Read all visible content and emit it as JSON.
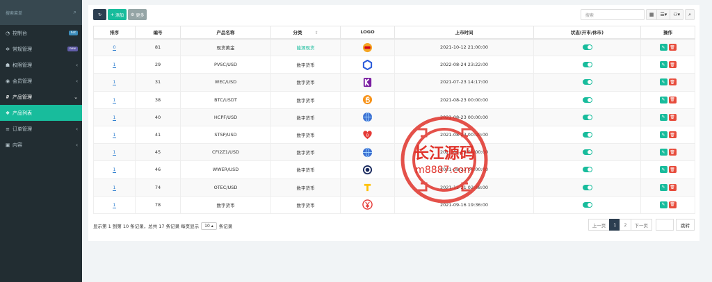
{
  "sidebar": {
    "search_placeholder": "搜索菜单",
    "items": [
      {
        "label": "控制台",
        "icon": "dashboard-icon",
        "badge": "hot",
        "badge_color": "#3c8dbc"
      },
      {
        "label": "常规管理",
        "icon": "cogs-icon",
        "badge": "new",
        "badge_color": "#605ca8"
      },
      {
        "label": "权限管理",
        "icon": "users-icon",
        "chevron": "‹"
      },
      {
        "label": "会员管理",
        "icon": "user-circle-icon",
        "chevron": "‹"
      },
      {
        "label": "产品管理",
        "icon": "product-icon",
        "chevron": "⌄"
      },
      {
        "label": "产品列表",
        "icon": "cubes-icon"
      },
      {
        "label": "订单管理",
        "icon": "list-icon",
        "chevron": "‹"
      },
      {
        "label": "内容",
        "icon": "folder-icon",
        "chevron": "‹"
      }
    ]
  },
  "toolbar": {
    "refresh_icon": "↻",
    "add_label": "添加",
    "more_label": "更多"
  },
  "table_tools": {
    "search_placeholder": "搜索"
  },
  "table": {
    "headers": [
      "排序",
      "编号",
      "产品名称",
      "分类",
      "LOGO",
      "上市时间",
      "状态(开市/休市)",
      "操作"
    ],
    "rows": [
      {
        "sort": "0",
        "id": "81",
        "name": "现货黄金",
        "category": "能源现货",
        "logo": "gold-coin-icon",
        "date": "2021-10-12 21:00:00"
      },
      {
        "sort": "1",
        "id": "29",
        "name": "PVSC/USD",
        "category": "数字货币",
        "logo": "chainlink-icon",
        "date": "2022-08-24 23:22:00"
      },
      {
        "sort": "1",
        "id": "31",
        "name": "WEC/USD",
        "category": "数字货币",
        "logo": "kyber-k-icon",
        "date": "2021-07-23 14:17:00"
      },
      {
        "sort": "1",
        "id": "38",
        "name": "BTC/USDT",
        "category": "数字货币",
        "logo": "bitcoin-icon",
        "date": "2021-08-23 00:00:00"
      },
      {
        "sort": "1",
        "id": "40",
        "name": "HCPF/USD",
        "category": "数字货币",
        "logo": "crypto-globe-icon",
        "date": "2021-08-23 00:00:00"
      },
      {
        "sort": "1",
        "id": "41",
        "name": "STSP/USD",
        "category": "数字货币",
        "logo": "heart-coin-icon",
        "date": "2021-08-23 00:00:00"
      },
      {
        "sort": "1",
        "id": "45",
        "name": "CFI2Z1/USD",
        "category": "数字货币",
        "logo": "crypto-globe-icon",
        "date": "2021-08-23 00:00:00"
      },
      {
        "sort": "1",
        "id": "46",
        "name": "WWER/USD",
        "category": "数字货币",
        "logo": "ring-coin-icon",
        "date": "2021-08-23 00:00:00"
      },
      {
        "sort": "1",
        "id": "74",
        "name": "OTEC/USD",
        "category": "数字货币",
        "logo": "token-t-icon",
        "date": "2021-12-21 02:48:00"
      },
      {
        "sort": "1",
        "id": "78",
        "name": "数字货币",
        "category": "数字货币",
        "logo": "yuan-coin-icon",
        "date": "2021-09-16 19:36:00"
      }
    ]
  },
  "footer": {
    "info_prefix": "显示第 1 到第 10 条记录，总共 17 条记录 每页显示",
    "page_size": "10",
    "info_suffix": "条记录"
  },
  "pagination": {
    "prev": "上一页",
    "pages": [
      "1",
      "2"
    ],
    "next": "下一页",
    "go": "跳转"
  },
  "watermark": {
    "line1": "长江源码",
    "line2": "m8887.com"
  },
  "colors": {
    "sidebar_bg": "#222d32",
    "accent": "#18bc9c",
    "danger": "#e74c3c",
    "dark_button": "#2c3e50"
  }
}
